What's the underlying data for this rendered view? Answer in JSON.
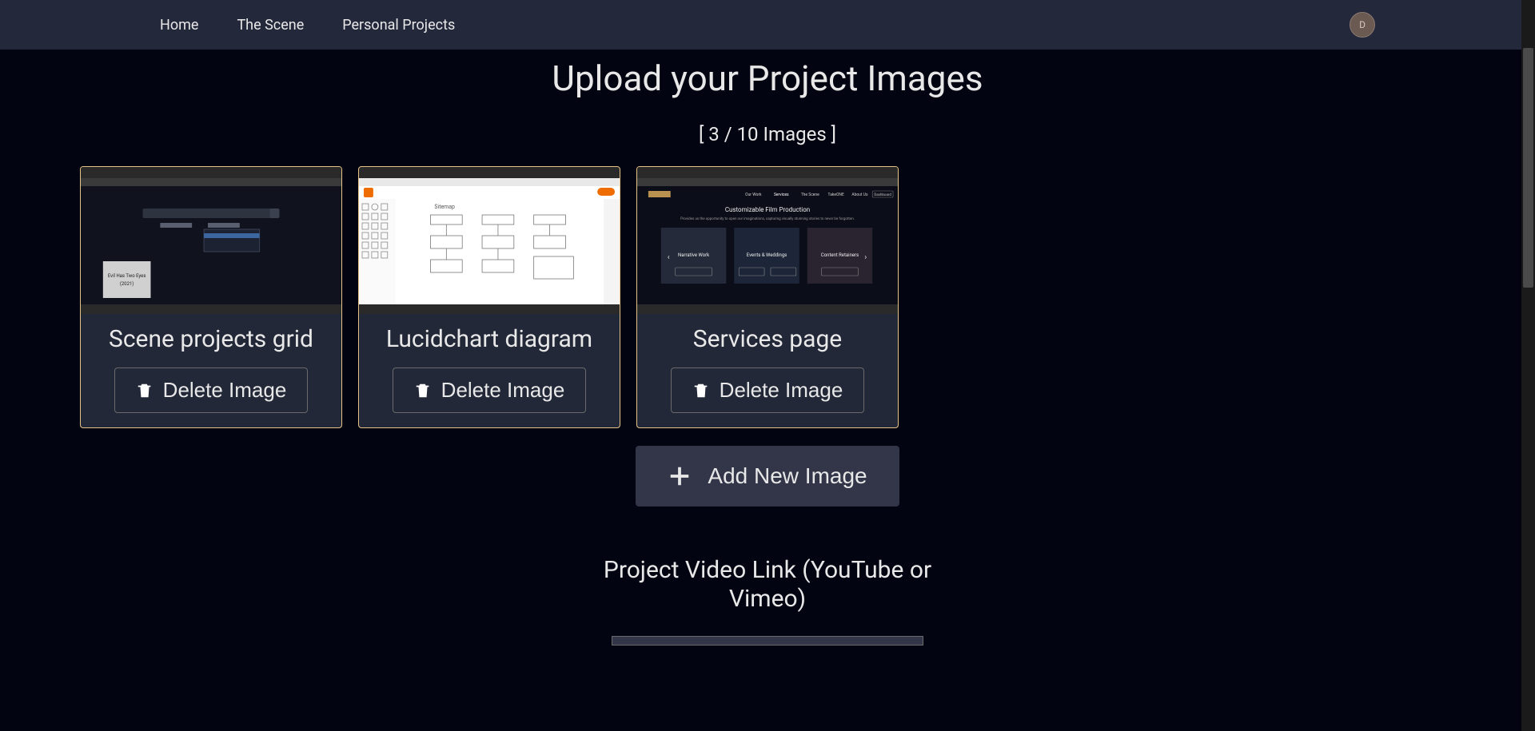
{
  "nav": {
    "items": [
      {
        "label": "Home"
      },
      {
        "label": "The Scene"
      },
      {
        "label": "Personal Projects"
      }
    ],
    "avatar_initial": "D"
  },
  "page": {
    "title": "Upload your Project Images",
    "counter": "[ 3 / 10 Images ]"
  },
  "cards": [
    {
      "title": "Scene projects grid",
      "delete_label": "Delete Image"
    },
    {
      "title": "Lucidchart diagram",
      "delete_label": "Delete Image"
    },
    {
      "title": "Services page",
      "delete_label": "Delete Image"
    }
  ],
  "add_button": {
    "label": "Add New Image"
  },
  "video_section": {
    "title_line1": "Project Video Link (YouTube or",
    "title_line2": "Vimeo)"
  }
}
